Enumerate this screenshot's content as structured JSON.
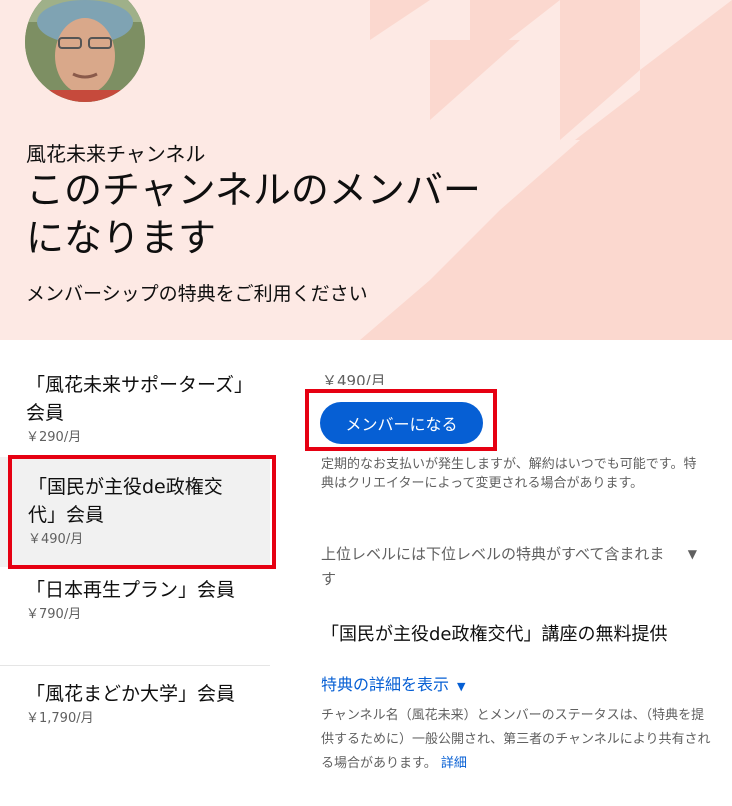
{
  "header": {
    "channel_name": "風花未来チャンネル",
    "title": "このチャンネルのメンバーになります",
    "subtitle": "メンバーシップの特典をご利用ください",
    "background_color": "#fde9e4",
    "decoration_color": "#fbd8cf"
  },
  "tiers": [
    {
      "name": "「風花未来サポーターズ」会員",
      "price": "￥290/月",
      "selected": false
    },
    {
      "name": "「国民が主役de政権交代」会員",
      "price": "￥490/月",
      "selected": true
    },
    {
      "name": "「日本再生プラン」会員",
      "price": "￥790/月",
      "selected": false
    },
    {
      "name": "「風花まどか大学」会員",
      "price": "￥1,790/月",
      "selected": false
    }
  ],
  "selected_tier": {
    "price": "￥490/月",
    "join_button_label": "メンバーになる",
    "billing_note": "定期的なお支払いが発生しますが、解約はいつでも可能です。特典はクリエイターによって変更される場合があります。",
    "perks_toggle_label": "上位レベルには下位レベルの特典がすべて含まれます",
    "perk_title": "「国民が主役de政権交代」講座の無料提供",
    "perk_details_link": "特典の詳細を表示",
    "privacy_note": "チャンネル名（風花未来）とメンバーのステータスは、（特典を提供するために）一般公開され、第三者のチャンネルにより共有される場合があります。",
    "privacy_link": "詳細"
  },
  "colors": {
    "accent": "#065fd4",
    "highlight": "#e60012",
    "selected_bg": "#f1f1f1"
  }
}
